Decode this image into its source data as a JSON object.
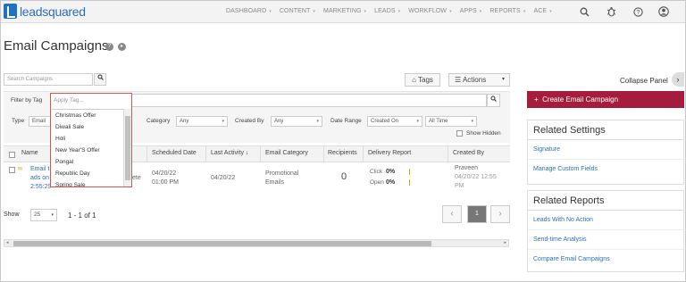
{
  "nav": {
    "brand": "leadsquared",
    "links": [
      "DASHBOARD",
      "CONTENT",
      "MARKETING",
      "LEADS",
      "WORKFLOW",
      "APPS",
      "REPORTS",
      "ACE"
    ]
  },
  "page": {
    "title": "Email Campaigns"
  },
  "search": {
    "placeholder": "Search Campaigns"
  },
  "toolbar": {
    "tags_label": "Tags",
    "actions_label": "Actions"
  },
  "filters": {
    "filter_by_tag_label": "Filter by Tag",
    "tag_placeholder": "Apply Tag...",
    "type_label": "Type",
    "type_value": "Email",
    "category_label": "Category",
    "category_value": "Any",
    "created_by_label": "Created By",
    "created_by_value": "Any",
    "date_range_label": "Date Range",
    "date_field_value": "Created On",
    "date_range_value": "All Time",
    "show_hidden_label": "Show Hidden"
  },
  "tag_dropdown": {
    "options": [
      "Christmas Offer",
      "Diwali Sale",
      "Holi",
      "New Year'S Offer",
      "Pongal",
      "Republic Day",
      "Spring Sale"
    ]
  },
  "table": {
    "columns": [
      "Name",
      "Scheduled Date",
      "Last Activity",
      "Email Category",
      "Recipients",
      "Delivery Report",
      "Created By"
    ],
    "rows": [
      {
        "name_line1": "Email t",
        "name_line2": "ads on",
        "name_line3": "2:55:29",
        "obscured_action": "ete",
        "scheduled_date": "04/20/22",
        "scheduled_time": "01:00 PM",
        "last_activity": "04/20/22",
        "category_line1": "Promotional",
        "category_line2": "Emails",
        "recipients": "0",
        "click_label": "Click",
        "click_value": "0%",
        "open_label": "Open",
        "open_value": "0%",
        "created_by": "Praveen",
        "created_date": "04/20/22 12:55",
        "created_time": "PM"
      }
    ]
  },
  "pagination": {
    "show_label": "Show",
    "page_size": "25",
    "range_text": "1 - 1 of 1",
    "current_page": "1"
  },
  "sidebar": {
    "collapse_label": "Collapse Panel",
    "create_button": "Create Email Campaign",
    "settings_title": "Related Settings",
    "settings_links": [
      "Signature",
      "Manage Custom Fields"
    ],
    "reports_title": "Related Reports",
    "report_links": [
      "Leads With No Action",
      "Send-time Analysis",
      "Compare Email Campaigns"
    ]
  },
  "colors": {
    "brand_blue": "#2d6fb7",
    "create_button": "#a61c3c",
    "dropdown_highlight": "#d9534f",
    "delivery_bar": "#e0a800"
  }
}
